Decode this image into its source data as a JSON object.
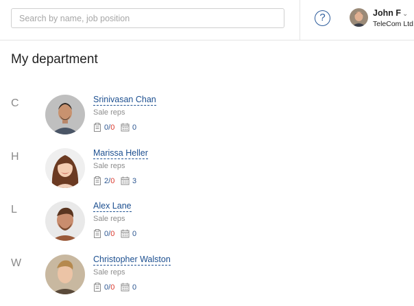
{
  "header": {
    "search_placeholder": "Search by name, job position",
    "help_symbol": "?",
    "user": {
      "name": "John F",
      "company": "TeleCom Ltd."
    }
  },
  "page": {
    "title": "My department"
  },
  "groups": [
    {
      "letter": "C",
      "employee": {
        "name": "Srinivasan Chan",
        "position": "Sale reps",
        "tasks_done": "0",
        "tasks_overdue": "0",
        "events": "0"
      }
    },
    {
      "letter": "H",
      "employee": {
        "name": "Marissa Heller",
        "position": "Sale reps",
        "tasks_done": "2",
        "tasks_overdue": "0",
        "events": "3"
      }
    },
    {
      "letter": "L",
      "employee": {
        "name": "Alex Lane",
        "position": "Sale reps",
        "tasks_done": "0",
        "tasks_overdue": "0",
        "events": "0"
      }
    },
    {
      "letter": "W",
      "employee": {
        "name": "Christopher Walston",
        "position": "Sale reps",
        "tasks_done": "0",
        "tasks_overdue": "0",
        "events": "0"
      }
    }
  ],
  "colors": {
    "link": "#1b4e8f",
    "overdue": "#d9362b",
    "muted": "#8c8c8c"
  },
  "icons": {
    "tasks": "clipboard-icon",
    "events": "calendar-icon",
    "help": "help-circle-icon",
    "user_menu": "chevron-down-icon"
  }
}
